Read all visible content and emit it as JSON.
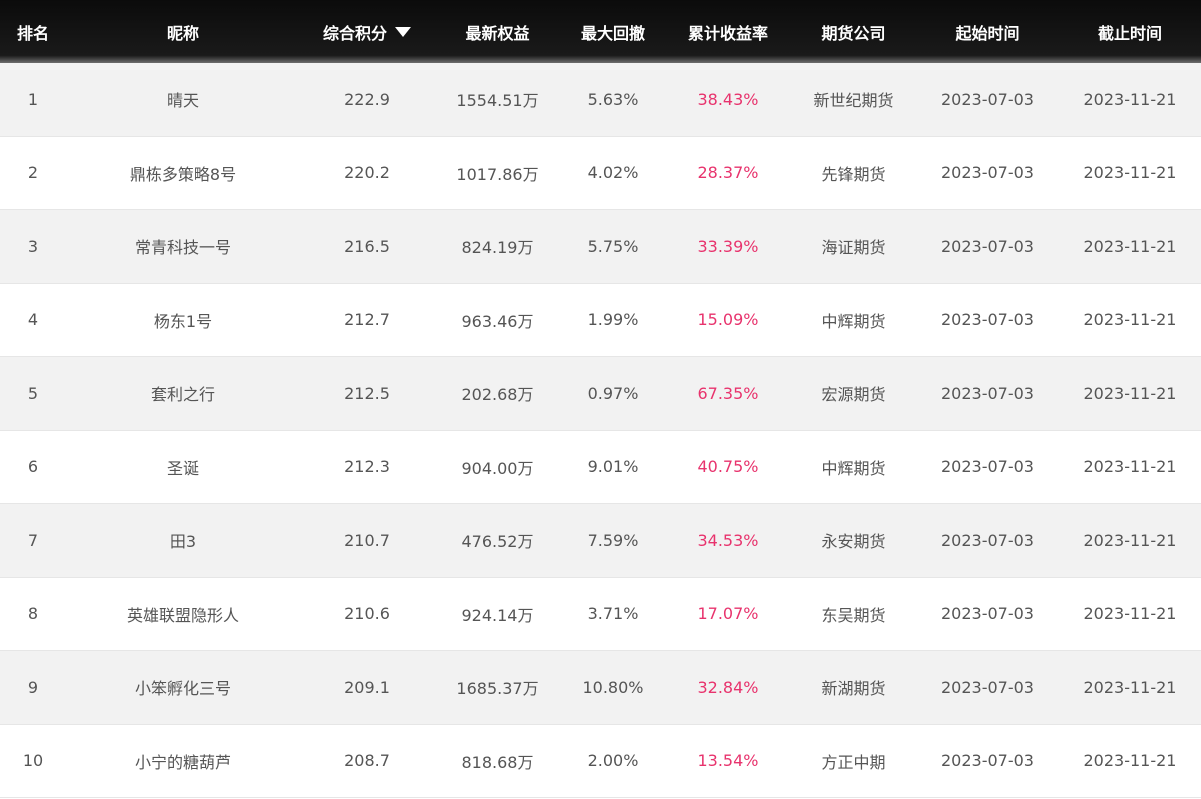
{
  "table": {
    "headers": {
      "rank": "排名",
      "name": "昵称",
      "score": "综合积分",
      "equity": "最新权益",
      "drawdown": "最大回撤",
      "return": "累计收益率",
      "company": "期货公司",
      "start": "起始时间",
      "end": "截止时间"
    },
    "sort_icon": "caret-down-icon",
    "accent_return_color": "#e8336d",
    "header_bg": "#111111",
    "rows": [
      {
        "rank": "1",
        "name": "晴天",
        "score": "222.9",
        "equity": "1554.51万",
        "drawdown": "5.63%",
        "return": "38.43%",
        "company": "新世纪期货",
        "start": "2023-07-03",
        "end": "2023-11-21"
      },
      {
        "rank": "2",
        "name": "鼎栋多策略8号",
        "score": "220.2",
        "equity": "1017.86万",
        "drawdown": "4.02%",
        "return": "28.37%",
        "company": "先锋期货",
        "start": "2023-07-03",
        "end": "2023-11-21"
      },
      {
        "rank": "3",
        "name": "常青科技一号",
        "score": "216.5",
        "equity": "824.19万",
        "drawdown": "5.75%",
        "return": "33.39%",
        "company": "海证期货",
        "start": "2023-07-03",
        "end": "2023-11-21"
      },
      {
        "rank": "4",
        "name": "杨东1号",
        "score": "212.7",
        "equity": "963.46万",
        "drawdown": "1.99%",
        "return": "15.09%",
        "company": "中辉期货",
        "start": "2023-07-03",
        "end": "2023-11-21"
      },
      {
        "rank": "5",
        "name": "套利之行",
        "score": "212.5",
        "equity": "202.68万",
        "drawdown": "0.97%",
        "return": "67.35%",
        "company": "宏源期货",
        "start": "2023-07-03",
        "end": "2023-11-21"
      },
      {
        "rank": "6",
        "name": "圣诞",
        "score": "212.3",
        "equity": "904.00万",
        "drawdown": "9.01%",
        "return": "40.75%",
        "company": "中辉期货",
        "start": "2023-07-03",
        "end": "2023-11-21"
      },
      {
        "rank": "7",
        "name": "田3",
        "score": "210.7",
        "equity": "476.52万",
        "drawdown": "7.59%",
        "return": "34.53%",
        "company": "永安期货",
        "start": "2023-07-03",
        "end": "2023-11-21"
      },
      {
        "rank": "8",
        "name": "英雄联盟隐形人",
        "score": "210.6",
        "equity": "924.14万",
        "drawdown": "3.71%",
        "return": "17.07%",
        "company": "东吴期货",
        "start": "2023-07-03",
        "end": "2023-11-21"
      },
      {
        "rank": "9",
        "name": "小笨孵化三号",
        "score": "209.1",
        "equity": "1685.37万",
        "drawdown": "10.80%",
        "return": "32.84%",
        "company": "新湖期货",
        "start": "2023-07-03",
        "end": "2023-11-21"
      },
      {
        "rank": "10",
        "name": "小宁的糖葫芦",
        "score": "208.7",
        "equity": "818.68万",
        "drawdown": "2.00%",
        "return": "13.54%",
        "company": "方正中期",
        "start": "2023-07-03",
        "end": "2023-11-21"
      }
    ]
  }
}
